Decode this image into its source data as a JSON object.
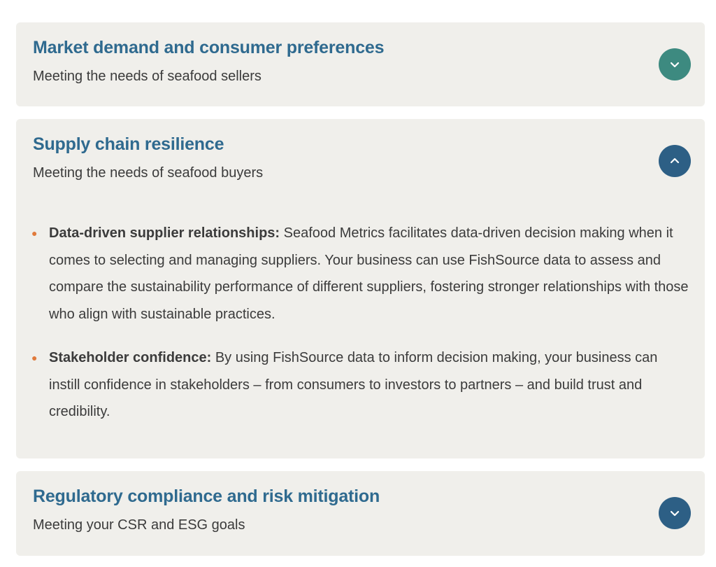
{
  "accordion": {
    "items": [
      {
        "title": "Market demand and consumer preferences",
        "subtitle": "Meeting the needs of seafood sellers",
        "state": "collapsed",
        "toggle_icon": "chevron-down-icon",
        "toggle_color": "#3d8a80"
      },
      {
        "title": "Supply chain resilience",
        "subtitle": "Meeting the needs of seafood buyers",
        "state": "expanded",
        "toggle_icon": "chevron-up-icon",
        "toggle_color": "#2d5f85",
        "bullets": [
          {
            "lead": "Data-driven supplier relationships:",
            "text": " Seafood Metrics facilitates data-driven decision making when it comes to selecting and managing suppliers. Your business can use FishSource data to assess and compare the sustainability performance of different suppliers, fostering stronger relationships with those who align with sustainable practices."
          },
          {
            "lead": "Stakeholder confidence:",
            "text": " By using FishSource data to inform decision making, your business can instill confidence in stakeholders – from consumers to investors to partners – and build trust and credibility."
          }
        ]
      },
      {
        "title": "Regulatory compliance and risk mitigation",
        "subtitle": "Meeting your CSR and ESG goals",
        "state": "collapsed",
        "toggle_icon": "chevron-down-icon",
        "toggle_color": "#2d5f85"
      }
    ]
  },
  "colors": {
    "panel_bg": "#f0efeb",
    "title": "#2f6a8f",
    "body_text": "#3b3b3b",
    "bullet_marker": "#e07a3c"
  }
}
